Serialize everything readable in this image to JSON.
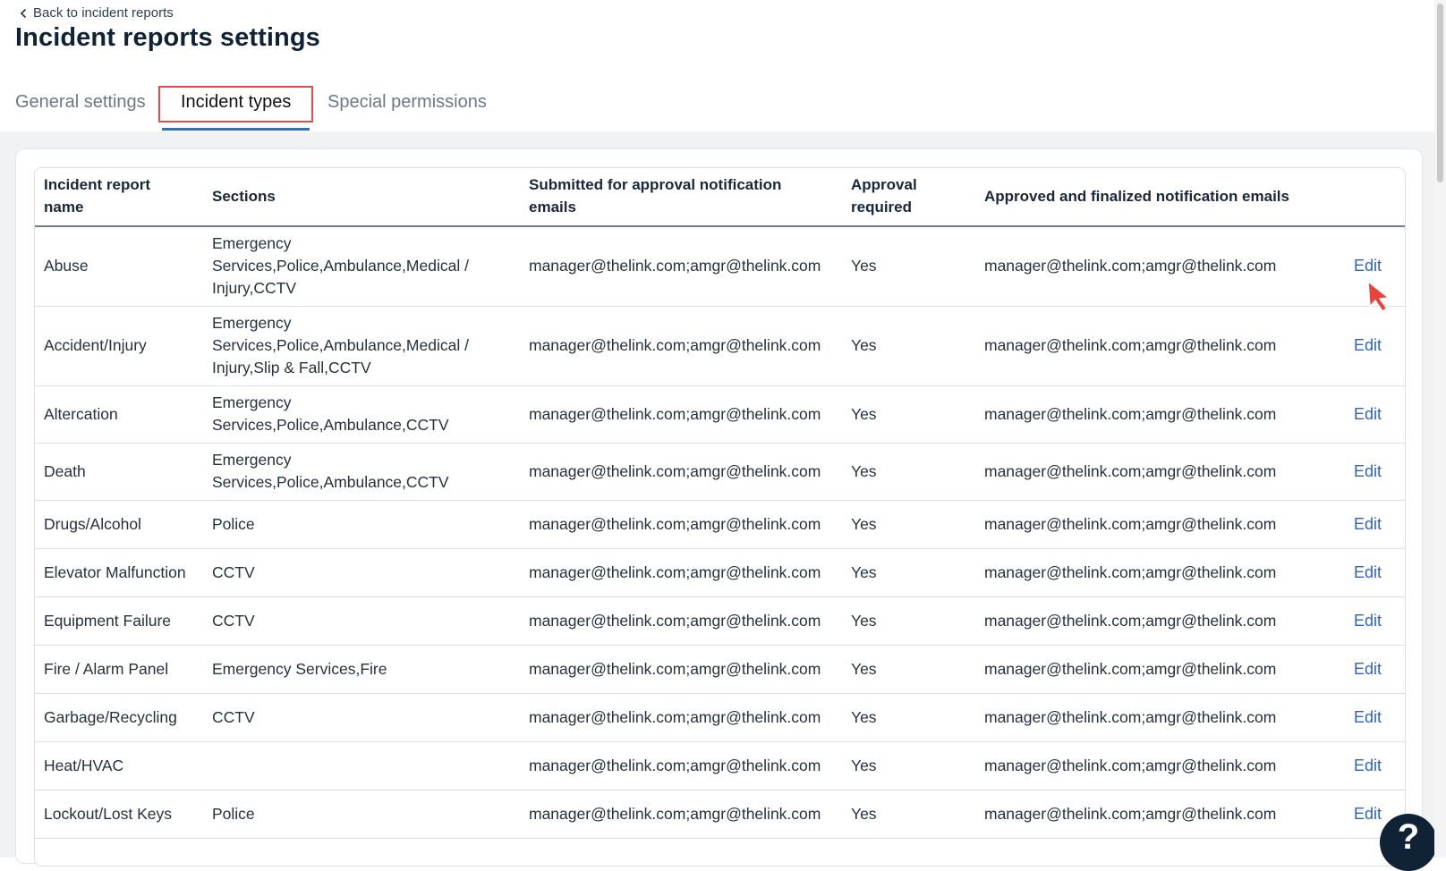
{
  "back_link": {
    "label": "Back to incident reports",
    "icon": "chevron-left-icon"
  },
  "page_title": "Incident reports settings",
  "tabs": [
    {
      "label": "General settings",
      "active": false
    },
    {
      "label": "Incident types",
      "active": true
    },
    {
      "label": "Special permissions",
      "active": false
    }
  ],
  "colors": {
    "accent": "#2f6fb8",
    "highlight_box": "#e04b4b",
    "link": "#2f63b8",
    "title": "#0f2236",
    "background": "#f1f2f4"
  },
  "table": {
    "headers": {
      "name": "Incident report name",
      "sections": "Sections",
      "submitted": "Submitted for approval notification emails",
      "approval": "Approval required",
      "approved": "Approved and finalized notification emails"
    },
    "rows": [
      {
        "name": "Abuse",
        "sections": "Emergency Services,Police,Ambulance,Medical / Injury,CCTV",
        "submitted": "manager@thelink.com;amgr@thelink.com",
        "approval": "Yes",
        "approved": "manager@thelink.com;amgr@thelink.com",
        "action": "Edit"
      },
      {
        "name": "Accident/Injury",
        "sections": "Emergency Services,Police,Ambulance,Medical / Injury,Slip & Fall,CCTV",
        "submitted": "manager@thelink.com;amgr@thelink.com",
        "approval": "Yes",
        "approved": "manager@thelink.com;amgr@thelink.com",
        "action": "Edit"
      },
      {
        "name": "Altercation",
        "sections": "Emergency Services,Police,Ambulance,CCTV",
        "submitted": "manager@thelink.com;amgr@thelink.com",
        "approval": "Yes",
        "approved": "manager@thelink.com;amgr@thelink.com",
        "action": "Edit"
      },
      {
        "name": "Death",
        "sections": "Emergency Services,Police,Ambulance,CCTV",
        "submitted": "manager@thelink.com;amgr@thelink.com",
        "approval": "Yes",
        "approved": "manager@thelink.com;amgr@thelink.com",
        "action": "Edit"
      },
      {
        "name": "Drugs/Alcohol",
        "sections": "Police",
        "submitted": "manager@thelink.com;amgr@thelink.com",
        "approval": "Yes",
        "approved": "manager@thelink.com;amgr@thelink.com",
        "action": "Edit"
      },
      {
        "name": "Elevator Malfunction",
        "sections": "CCTV",
        "submitted": "manager@thelink.com;amgr@thelink.com",
        "approval": "Yes",
        "approved": "manager@thelink.com;amgr@thelink.com",
        "action": "Edit"
      },
      {
        "name": "Equipment Failure",
        "sections": "CCTV",
        "submitted": "manager@thelink.com;amgr@thelink.com",
        "approval": "Yes",
        "approved": "manager@thelink.com;amgr@thelink.com",
        "action": "Edit"
      },
      {
        "name": "Fire / Alarm Panel",
        "sections": "Emergency Services,Fire",
        "submitted": "manager@thelink.com;amgr@thelink.com",
        "approval": "Yes",
        "approved": "manager@thelink.com;amgr@thelink.com",
        "action": "Edit"
      },
      {
        "name": "Garbage/Recycling",
        "sections": "CCTV",
        "submitted": "manager@thelink.com;amgr@thelink.com",
        "approval": "Yes",
        "approved": "manager@thelink.com;amgr@thelink.com",
        "action": "Edit"
      },
      {
        "name": "Heat/HVAC",
        "sections": "",
        "submitted": "manager@thelink.com;amgr@thelink.com",
        "approval": "Yes",
        "approved": "manager@thelink.com;amgr@thelink.com",
        "action": "Edit"
      },
      {
        "name": "Lockout/Lost Keys",
        "sections": "Police",
        "submitted": "manager@thelink.com;amgr@thelink.com",
        "approval": "Yes",
        "approved": "manager@thelink.com;amgr@thelink.com",
        "action": "Edit"
      }
    ]
  },
  "help_button": {
    "label": "?",
    "icon": "help-icon"
  }
}
